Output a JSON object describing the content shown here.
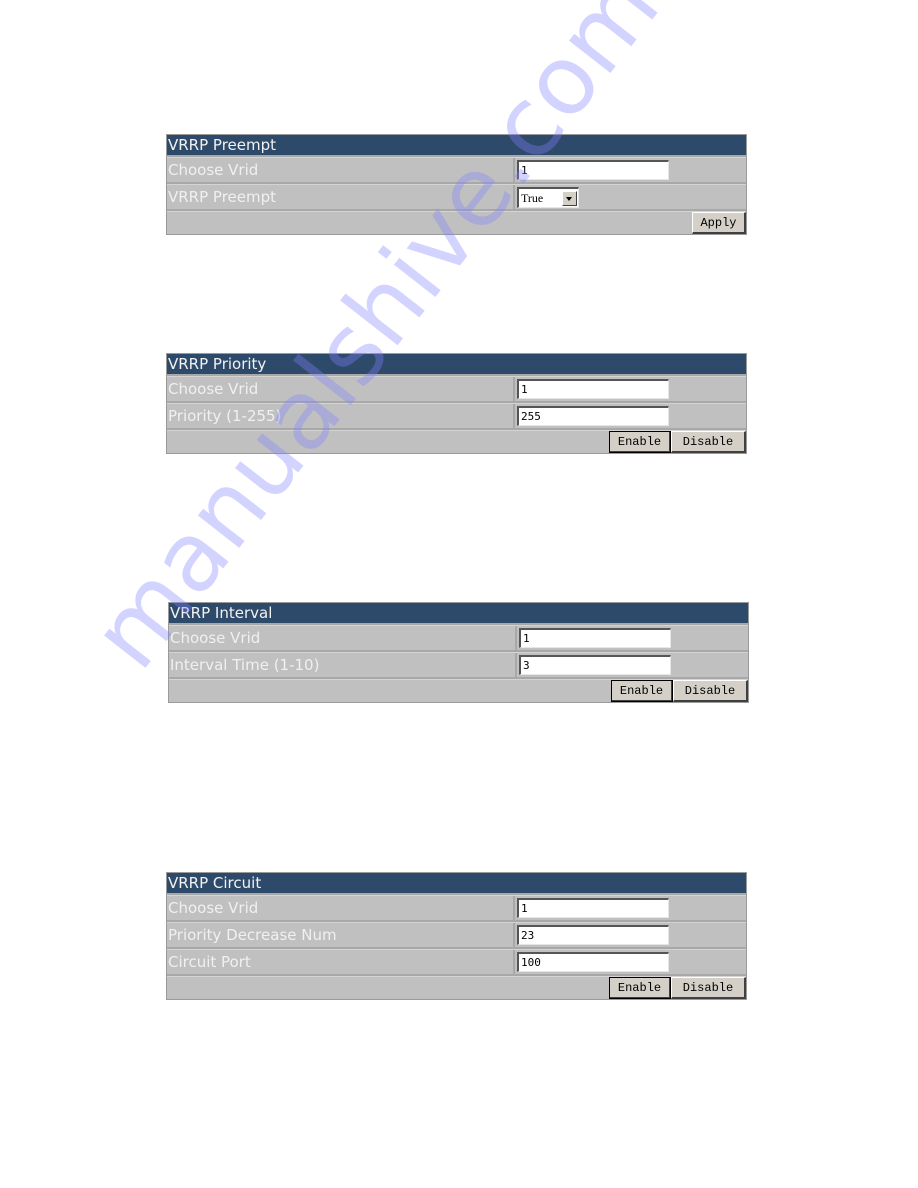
{
  "panels": {
    "preempt": {
      "title": "VRRP Preempt",
      "rows": [
        {
          "label": "Choose Vrid",
          "type": "text",
          "value": "1"
        },
        {
          "label": "VRRP Preempt",
          "type": "select",
          "value": "True",
          "icon": "dropdown-arrow-icon"
        }
      ],
      "buttons": [
        {
          "label": "Apply"
        }
      ]
    },
    "priority": {
      "title": "VRRP Priority",
      "rows": [
        {
          "label": "Choose Vrid",
          "type": "text",
          "value": "1"
        },
        {
          "label": "Priority (1-255)",
          "type": "text",
          "value": "255"
        }
      ],
      "buttons": [
        {
          "label": "Enable"
        },
        {
          "label": "Disable"
        }
      ]
    },
    "interval": {
      "title": "VRRP Interval",
      "rows": [
        {
          "label": "Choose Vrid",
          "type": "text",
          "value": "1"
        },
        {
          "label": "Interval Time (1-10)",
          "type": "text",
          "value": "3"
        }
      ],
      "buttons": [
        {
          "label": "Enable"
        },
        {
          "label": "Disable"
        }
      ]
    },
    "circuit": {
      "title": "VRRP Circuit",
      "rows": [
        {
          "label": "Choose Vrid",
          "type": "text",
          "value": "1"
        },
        {
          "label": "Priority Decrease Num",
          "type": "text",
          "value": "23"
        },
        {
          "label": "Circuit Port",
          "type": "text",
          "value": "100"
        }
      ],
      "buttons": [
        {
          "label": "Enable"
        },
        {
          "label": "Disable"
        }
      ]
    }
  },
  "watermark": "manualshive.com",
  "colors": {
    "header_bg": "#2e4a6b",
    "panel_bg": "#c0c0c0",
    "label_text": "#f0f0f0",
    "button_face": "#d4d0c8",
    "watermark": "#8282ff"
  }
}
